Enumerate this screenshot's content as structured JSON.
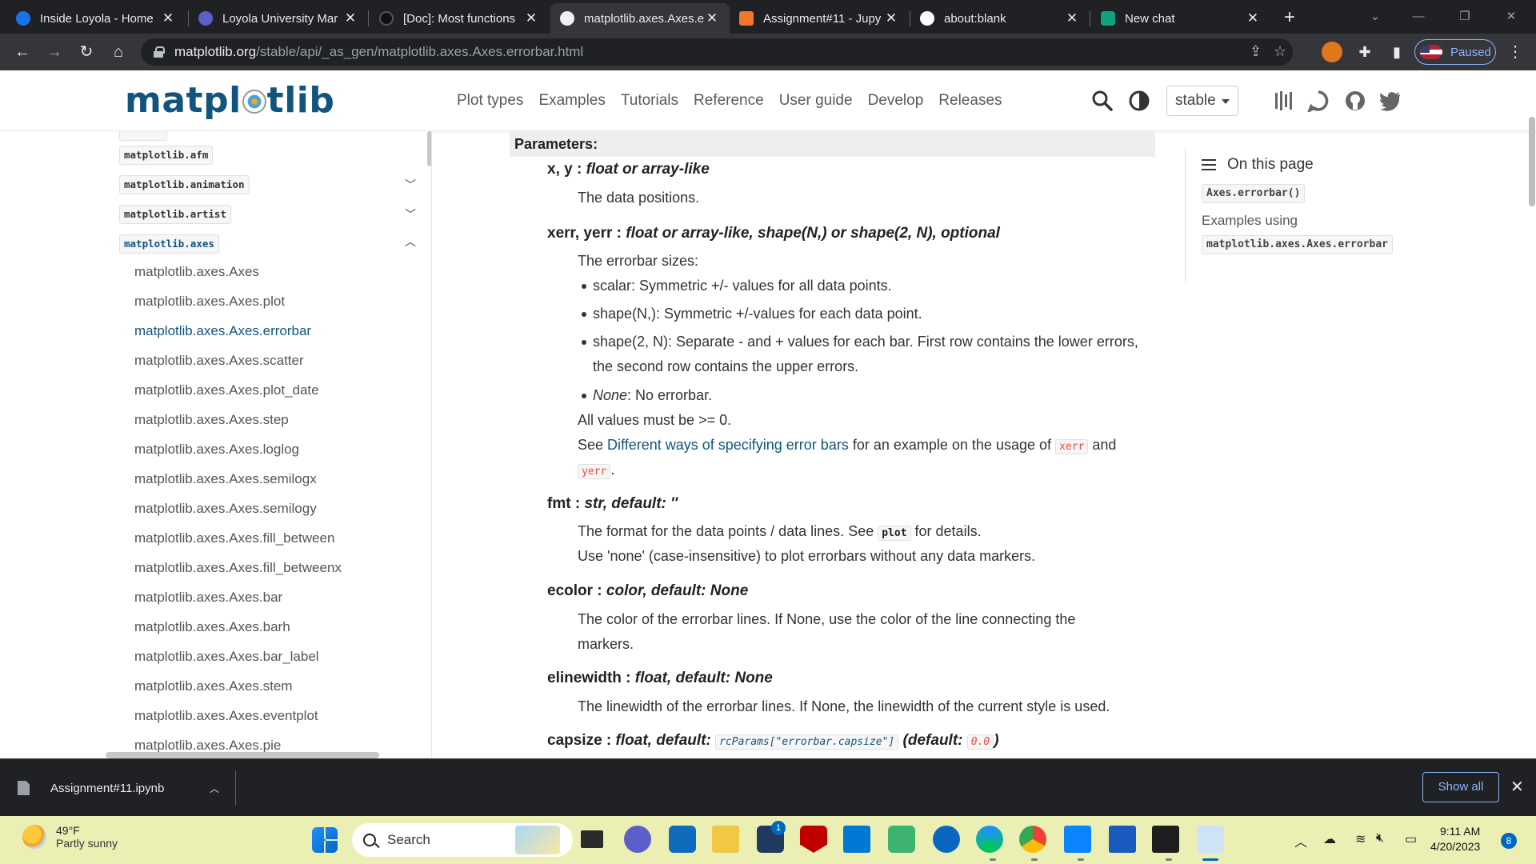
{
  "browser": {
    "tabs": [
      {
        "title": "Inside Loyola - Home",
        "favicon_color": "#1a73e8"
      },
      {
        "title": "Loyola University Mar",
        "favicon_color": "#5b5fc7"
      },
      {
        "title": "[Doc]: Most functions",
        "favicon_color": "#000000"
      },
      {
        "title": "matplotlib.axes.Axes.e",
        "favicon_color": "#f5f5f5"
      },
      {
        "title": "Assignment#11 - Jupy",
        "favicon_color": "#f37726"
      },
      {
        "title": "about:blank",
        "favicon_color": "#ffffff"
      },
      {
        "title": "New chat",
        "favicon_color": "#10a37f"
      }
    ],
    "active_tab_index": 3,
    "url_domain": "matplotlib.org",
    "url_path": "/stable/api/_as_gen/matplotlib.axes.Axes.errorbar.html",
    "profile_label": "Paused"
  },
  "site": {
    "logo_text_1": "matpl",
    "logo_text_2": "tlib",
    "nav": [
      "Plot types",
      "Examples",
      "Tutorials",
      "Reference",
      "User guide",
      "Develop",
      "Releases"
    ],
    "version": "stable"
  },
  "sidebar": {
    "modules": [
      {
        "label": "matplotlib.afm",
        "expandable": false
      },
      {
        "label": "matplotlib.animation",
        "expandable": true
      },
      {
        "label": "matplotlib.artist",
        "expandable": true
      },
      {
        "label": "matplotlib.axes",
        "expandable": true,
        "expanded": true
      }
    ],
    "items": [
      "matplotlib.axes.Axes",
      "matplotlib.axes.Axes.plot",
      "matplotlib.axes.Axes.errorbar",
      "matplotlib.axes.Axes.scatter",
      "matplotlib.axes.Axes.plot_date",
      "matplotlib.axes.Axes.step",
      "matplotlib.axes.Axes.loglog",
      "matplotlib.axes.Axes.semilogx",
      "matplotlib.axes.Axes.semilogy",
      "matplotlib.axes.Axes.fill_between",
      "matplotlib.axes.Axes.fill_betweenx",
      "matplotlib.axes.Axes.bar",
      "matplotlib.axes.Axes.barh",
      "matplotlib.axes.Axes.bar_label",
      "matplotlib.axes.Axes.stem",
      "matplotlib.axes.Axes.eventplot",
      "matplotlib.axes.Axes.pie"
    ],
    "current_item_index": 2
  },
  "content": {
    "params_header": "Parameters:",
    "xy": {
      "name": "x, y",
      "type": "float or array-like",
      "desc": "The data positions."
    },
    "xerr": {
      "name": "xerr, yerr",
      "type": "float or array-like, shape(N,) or shape(2, N), optional",
      "desc": "The errorbar sizes:",
      "bullets": [
        "scalar: Symmetric +/- values for all data points.",
        "shape(N,): Symmetric +/-values for each data point.",
        "shape(2, N): Separate - and + values for each bar. First row contains the lower errors,",
        "the second row contains the upper errors."
      ],
      "none_word": "None",
      "none_rest": ": No errorbar.",
      "all_values": "All values must be >= 0.",
      "see_prefix": "See ",
      "see_link": "Different ways of specifying error bars",
      "see_mid": " for an example on the usage of ",
      "code_xerr": "xerr",
      "and_word": " and",
      "code_yerr": "yerr",
      "period": "."
    },
    "fmt": {
      "name": "fmt",
      "type": "str, default: ''",
      "desc1_pre": "The format for the data points / data lines. See ",
      "desc1_code": "plot",
      "desc1_post": " for details.",
      "desc2": "Use 'none' (case-insensitive) to plot errorbars without any data markers."
    },
    "ecolor": {
      "name": "ecolor",
      "type": "color, default: None",
      "desc1": "The color of the errorbar lines. If None, use the color of the line connecting the",
      "desc2": "markers."
    },
    "elinewidth": {
      "name": "elinewidth",
      "type": "float, default: None",
      "desc": "The linewidth of the errorbar lines. If None, the linewidth of the current style is used."
    },
    "capsize": {
      "name": "capsize",
      "type_pre": "float, default: ",
      "code": "rcParams[\"errorbar.capsize\"]",
      "type_mid": " (default: ",
      "code2": "0.0",
      "type_post": ")"
    }
  },
  "toc": {
    "header": "On this page",
    "code1": "Axes.errorbar()",
    "examples_label": "Examples using",
    "code2": "matplotlib.axes.Axes.errorbar"
  },
  "downloads": {
    "file": "Assignment#11.ipynb",
    "show_all": "Show all"
  },
  "taskbar": {
    "temp": "49°F",
    "weather": "Partly sunny",
    "search_placeholder": "Search",
    "time": "9:11 AM",
    "date": "4/20/2023",
    "notif_count": "8",
    "store_badge": "1"
  }
}
